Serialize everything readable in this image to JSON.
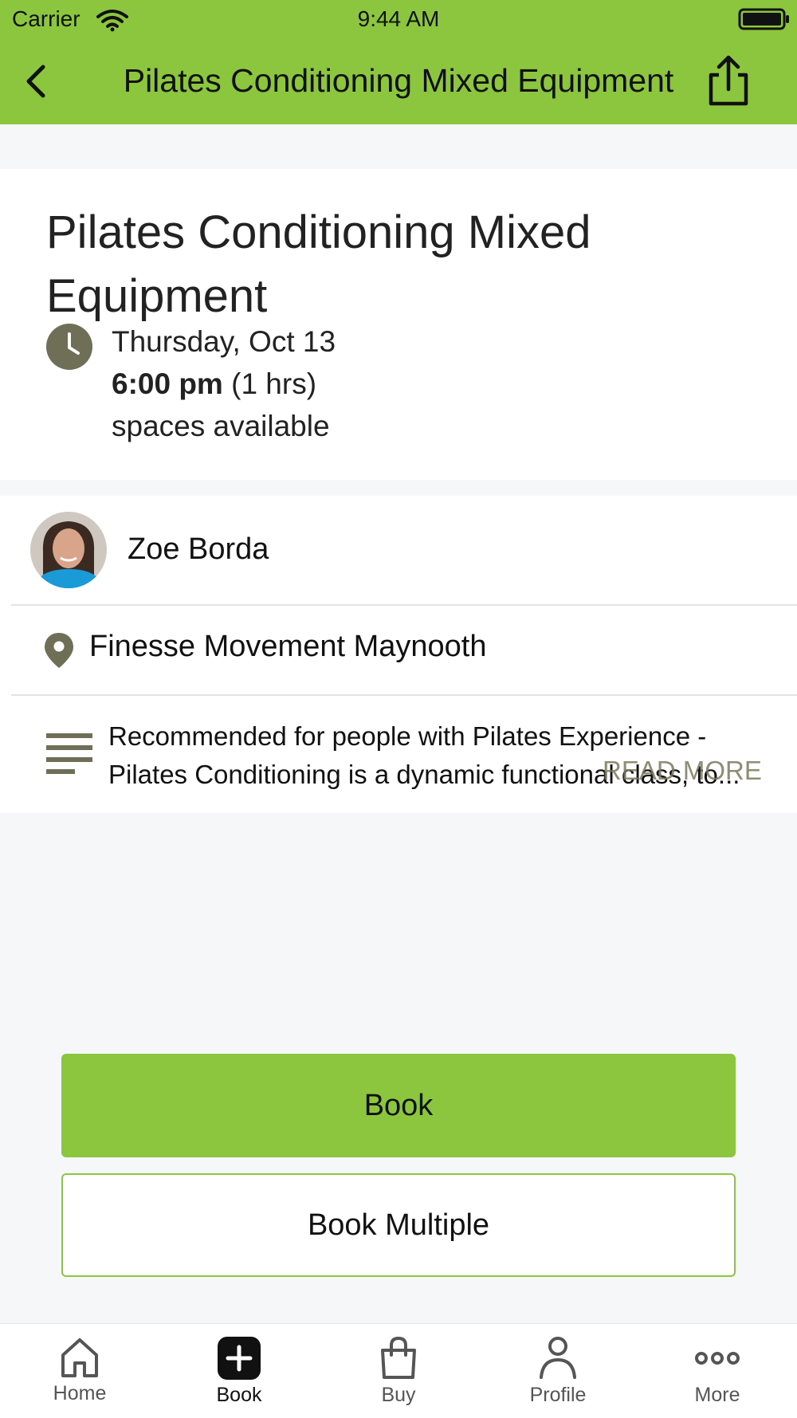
{
  "status_bar": {
    "carrier": "Carrier",
    "time": "9:44 AM"
  },
  "nav": {
    "title": "Pilates Conditioning Mixed Equipment",
    "back_icon": "chevron-left-icon",
    "share_icon": "share-icon"
  },
  "class_info": {
    "title": "Pilates Conditioning Mixed Equipment",
    "date": "Thursday, Oct 13",
    "time": "6:00 pm",
    "duration": "(1 hrs)",
    "availability": "spaces available"
  },
  "details": {
    "instructor": "Zoe Borda",
    "location": "Finesse Movement Maynooth",
    "description": "Recommended for people with Pilates Experience - Pilates Conditioning is a dynamic functional class, to...",
    "description_line1": "Recommended for people with Pilates Experience -",
    "description_line2": "Pilates Conditioning is a dynamic functional class, to...",
    "read_more": "READ MORE"
  },
  "actions": {
    "book": "Book",
    "book_multiple": "Book Multiple"
  },
  "tabs": [
    {
      "label": "Home",
      "icon": "home-icon",
      "active": false
    },
    {
      "label": "Book",
      "icon": "plus-icon",
      "active": true
    },
    {
      "label": "Buy",
      "icon": "shopping-bag-icon",
      "active": false
    },
    {
      "label": "Profile",
      "icon": "person-icon",
      "active": false
    },
    {
      "label": "More",
      "icon": "more-dots-icon",
      "active": false
    }
  ],
  "colors": {
    "accent": "#8cc63f",
    "muted": "#6f6f58"
  }
}
